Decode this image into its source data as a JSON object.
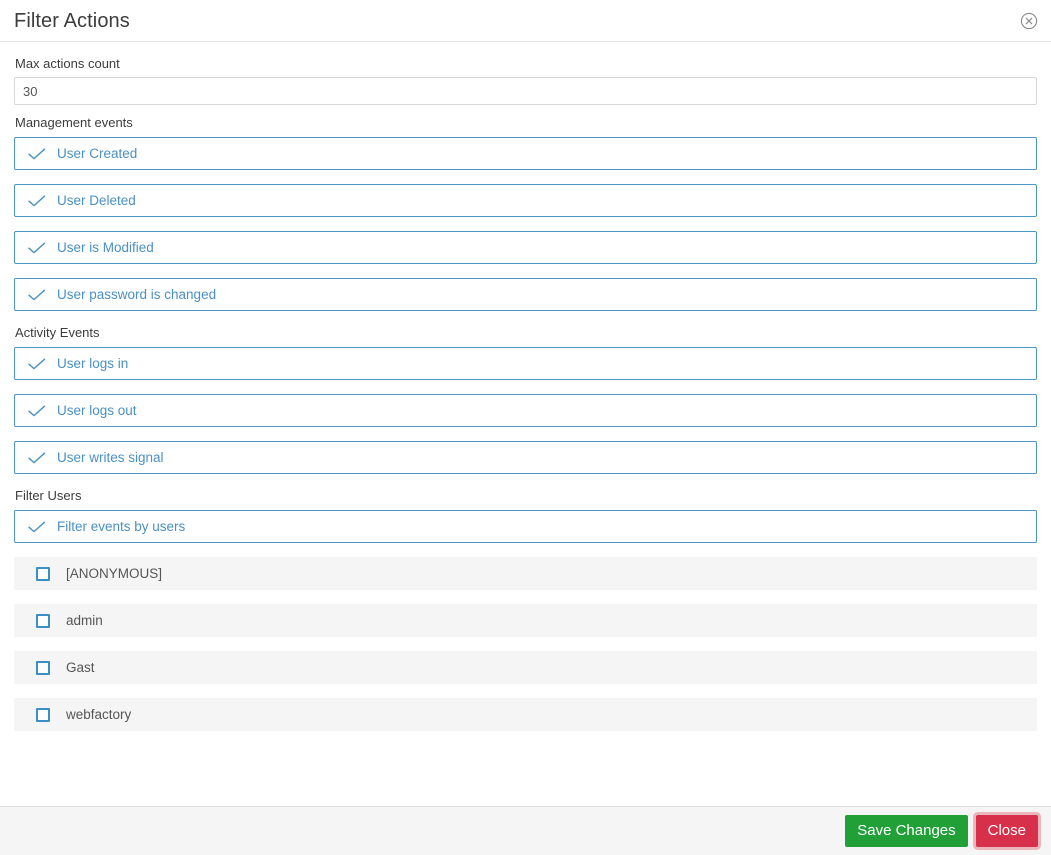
{
  "header": {
    "title": "Filter Actions",
    "close_icon": "close-circle-icon"
  },
  "body": {
    "max_actions": {
      "label": "Max actions count",
      "value": "30",
      "placeholder": ""
    },
    "management_events": {
      "label": "Management events",
      "items": [
        {
          "label": "User Created",
          "checked": true,
          "icon": "check-icon"
        },
        {
          "label": "User Deleted",
          "checked": true,
          "icon": "check-icon"
        },
        {
          "label": "User is Modified",
          "checked": true,
          "icon": "check-icon"
        },
        {
          "label": "User password is changed",
          "checked": true,
          "icon": "check-icon"
        }
      ]
    },
    "activity_events": {
      "label": "Activity Events",
      "items": [
        {
          "label": "User logs in",
          "checked": true,
          "icon": "check-icon"
        },
        {
          "label": "User logs out",
          "checked": true,
          "icon": "check-icon"
        },
        {
          "label": "User writes signal",
          "checked": true,
          "icon": "check-icon"
        }
      ]
    },
    "filter_users": {
      "label": "Filter Users",
      "toggle": {
        "label": "Filter events by users",
        "checked": true,
        "icon": "check-icon"
      },
      "users": [
        {
          "label": "[ANONYMOUS]",
          "checked": false,
          "icon": "checkbox-empty-icon"
        },
        {
          "label": "admin",
          "checked": false,
          "icon": "checkbox-empty-icon"
        },
        {
          "label": "Gast",
          "checked": false,
          "icon": "checkbox-empty-icon"
        },
        {
          "label": "webfactory",
          "checked": false,
          "icon": "checkbox-empty-icon"
        }
      ]
    }
  },
  "footer": {
    "save_label": "Save Changes",
    "close_label": "Close"
  },
  "colors": {
    "accent_blue": "#4a90c4",
    "border_blue": "#4d97c4",
    "save_green": "#22a038",
    "close_red": "#d6304a",
    "row_gray": "#f5f5f5",
    "text_dark": "#3c3c3c"
  }
}
